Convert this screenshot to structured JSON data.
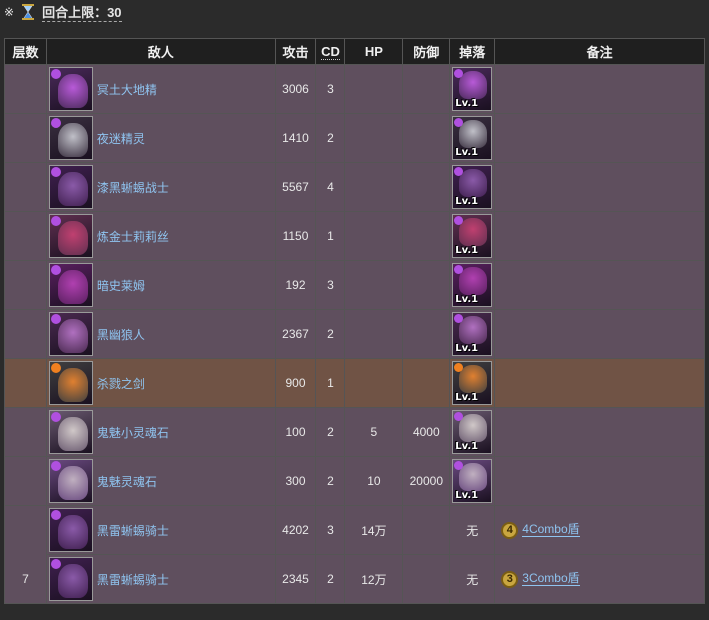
{
  "header": {
    "symbol": "※",
    "turn_limit": "回合上限：30"
  },
  "columns": {
    "layer": "层数",
    "enemy": "敌人",
    "attack": "攻击",
    "cd": "CD",
    "hp": "HP",
    "defense": "防御",
    "drop": "掉落",
    "note": "备注"
  },
  "colors": {
    "row_bg": "#5f4f5e",
    "special_row_bg": "#705345",
    "link": "#8fc4f0"
  },
  "drop_level": "Lv.1",
  "rows": [
    {
      "name": "冥土大地精",
      "attack": "3006",
      "cd": "3",
      "hp": "",
      "defense": "",
      "drop": "Lv.1",
      "note": "",
      "icon": "dark-goblin-icon"
    },
    {
      "name": "夜迷精灵",
      "attack": "1410",
      "cd": "2",
      "hp": "",
      "defense": "",
      "drop": "Lv.1",
      "note": "",
      "icon": "night-elf-icon"
    },
    {
      "name": "漆黑蜥蜴战士",
      "attack": "5567",
      "cd": "4",
      "hp": "",
      "defense": "",
      "drop": "Lv.1",
      "note": "",
      "icon": "dark-lizard-warrior-icon"
    },
    {
      "name": "炼金士莉莉丝",
      "attack": "1150",
      "cd": "1",
      "hp": "",
      "defense": "",
      "drop": "Lv.1",
      "note": "",
      "icon": "alchemist-lilith-icon"
    },
    {
      "name": "暗史莱姆",
      "attack": "192",
      "cd": "3",
      "hp": "",
      "defense": "",
      "drop": "Lv.1",
      "note": "",
      "icon": "dark-slime-icon"
    },
    {
      "name": "黑幽狼人",
      "attack": "2367",
      "cd": "2",
      "hp": "",
      "defense": "",
      "drop": "Lv.1",
      "note": "",
      "icon": "dark-werewolf-icon"
    },
    {
      "name": "杀戮之剑",
      "attack": "900",
      "cd": "1",
      "hp": "",
      "defense": "",
      "drop": "Lv.1",
      "note": "",
      "icon": "slaughter-sword-icon"
    },
    {
      "name": "鬼魅小灵魂石",
      "attack": "100",
      "cd": "2",
      "hp": "5",
      "defense": "4000",
      "drop": "Lv.1",
      "note": "",
      "icon": "small-soul-stone-icon"
    },
    {
      "name": "鬼魅灵魂石",
      "attack": "300",
      "cd": "2",
      "hp": "10",
      "defense": "20000",
      "drop": "Lv.1",
      "note": "",
      "icon": "soul-stone-icon"
    }
  ],
  "layer7": {
    "layer": "7",
    "rows": [
      {
        "name": "黑雷蜥蜴骑士",
        "attack": "4202",
        "cd": "3",
        "hp": "14万",
        "defense": "",
        "drop": "无",
        "badge": "4",
        "note": "4Combo盾",
        "icon": "thunder-lizard-knight-icon"
      },
      {
        "name": "黑雷蜥蜴骑士",
        "attack": "2345",
        "cd": "2",
        "hp": "12万",
        "defense": "",
        "drop": "无",
        "badge": "3",
        "note": "3Combo盾",
        "icon": "thunder-lizard-knight-icon"
      }
    ]
  }
}
